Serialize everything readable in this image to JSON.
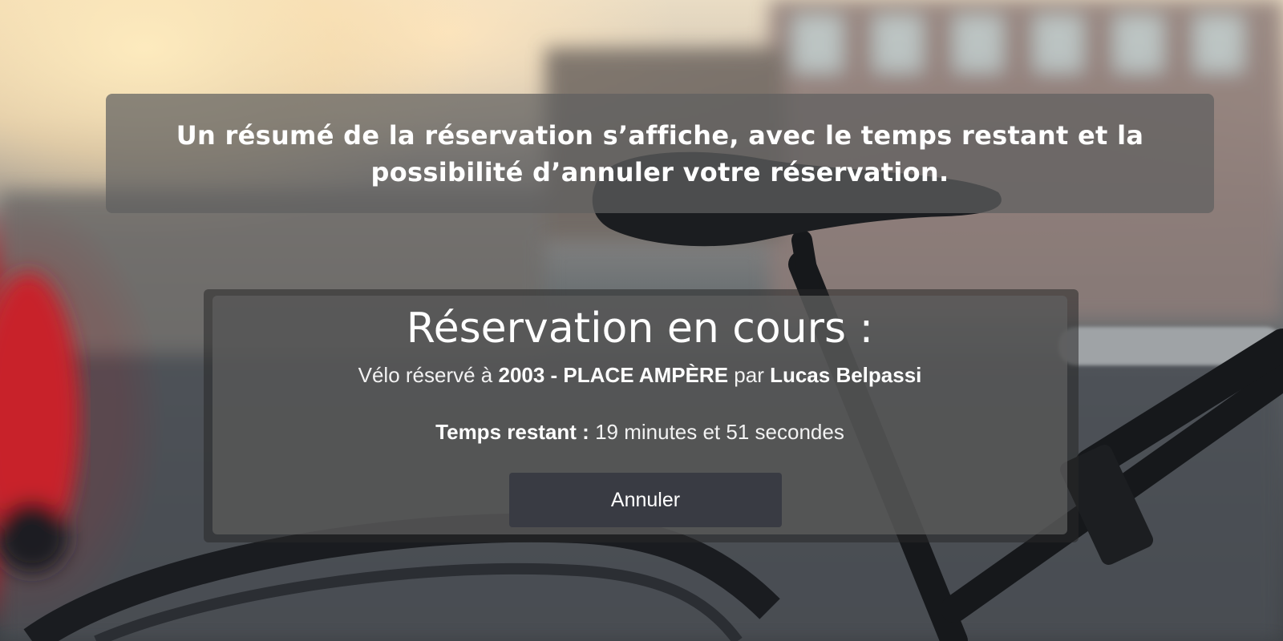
{
  "caption": {
    "text": "Un résumé de la réservation s’affiche, avec le temps restant et la possibilité d’annuler votre réservation."
  },
  "reservation": {
    "title": "Réservation en cours :",
    "bike_prefix": "Vélo réservé à ",
    "station": "2003 - PLACE AMPÈRE",
    "by_word": " par ",
    "user_name": "Lucas Belpassi",
    "time_label": "Temps restant :",
    "time_value": " 19 minutes et 51 secondes",
    "cancel_label": "Annuler"
  }
}
